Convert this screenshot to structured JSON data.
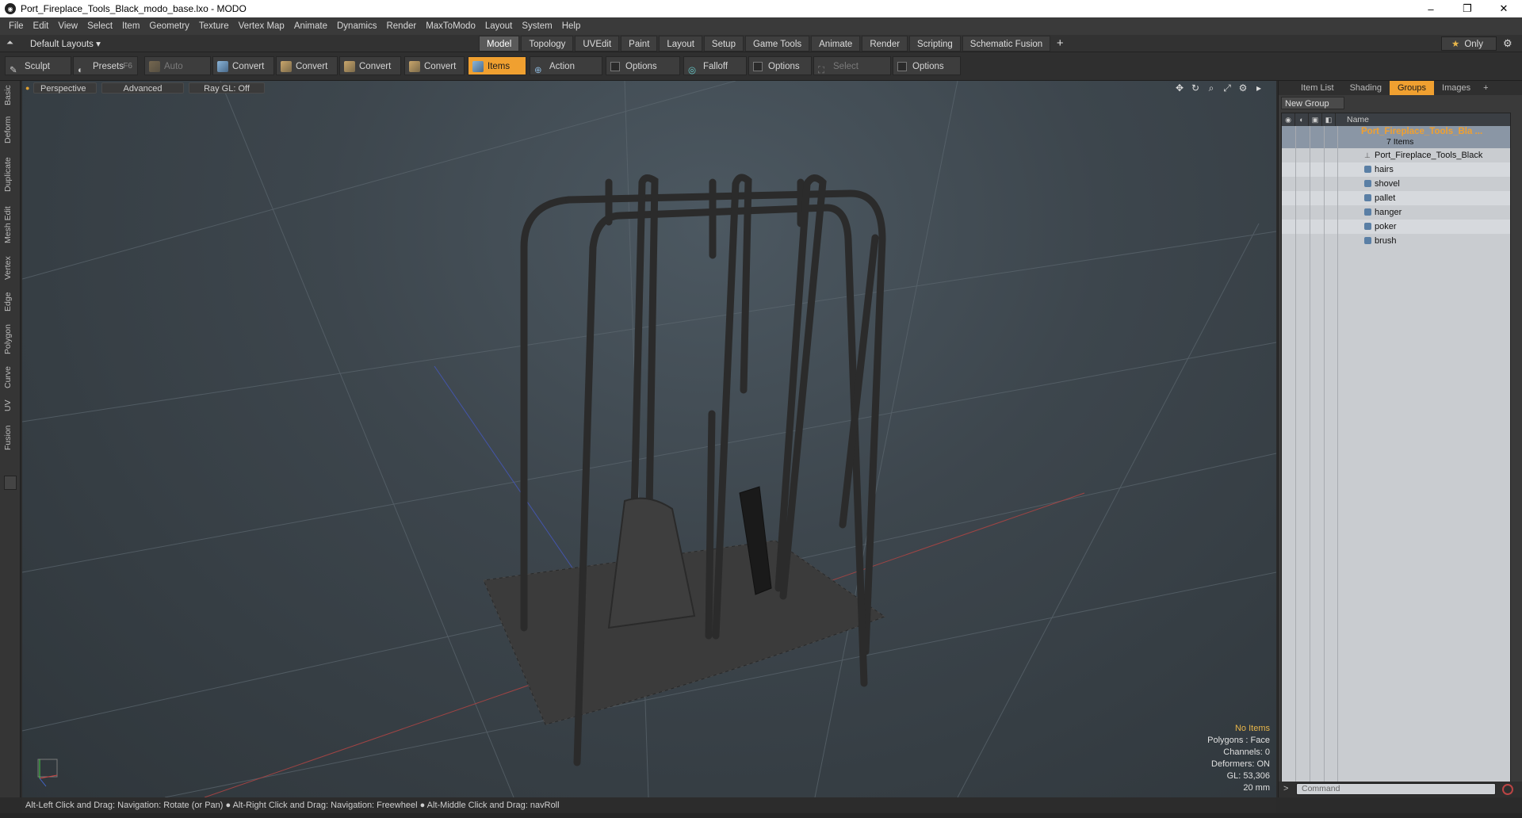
{
  "window": {
    "title": "Port_Fireplace_Tools_Black_modo_base.lxo - MODO",
    "min": "–",
    "max": "❐",
    "close": "✕"
  },
  "menu": [
    "File",
    "Edit",
    "View",
    "Select",
    "Item",
    "Geometry",
    "Texture",
    "Vertex Map",
    "Animate",
    "Dynamics",
    "Render",
    "MaxToModo",
    "Layout",
    "System",
    "Help"
  ],
  "layout": {
    "selector": "Default Layouts ▾",
    "tabs": [
      "Model",
      "Topology",
      "UVEdit",
      "Paint",
      "Layout",
      "Setup",
      "Game Tools",
      "Animate",
      "Render",
      "Scripting",
      "Schematic Fusion"
    ],
    "active_tab": "Model",
    "only": "Only",
    "plus": "+"
  },
  "toolbar": {
    "sculpt": "Sculpt",
    "presets": "Presets",
    "presets_key": "F6",
    "auto_select": "Auto Select",
    "convert": "Convert",
    "items": "Items",
    "action_center": "Action Center",
    "options": "Options",
    "falloff": "Falloff",
    "select_through": "Select Through"
  },
  "leftstrip": [
    "Basic",
    "Deform",
    "Duplicate",
    "Mesh Edit",
    "Vertex",
    "Edge",
    "Polygon",
    "Curve",
    "UV",
    "Fusion"
  ],
  "viewport": {
    "header": [
      "Perspective",
      "Advanced",
      "Ray GL: Off"
    ],
    "stats": {
      "items": "No Items",
      "polygons": "Polygons : Face",
      "channels": "Channels: 0",
      "deformers": "Deformers: ON",
      "gl": "GL: 53,306",
      "scale": "20 mm"
    }
  },
  "status": "Alt-Left Click and Drag: Navigation: Rotate (or Pan) ● Alt-Right Click and Drag: Navigation: Freewheel ● Alt-Middle Click and Drag: navRoll",
  "rightpanel": {
    "tabs": [
      "Item List",
      "Shading",
      "Groups",
      "Images"
    ],
    "active_tab": "Groups",
    "plus": "+",
    "new_group": "New Group",
    "column_name": "Name",
    "group": {
      "name": "Port_Fireplace_Tools_Bla ...",
      "count": "7 Items"
    },
    "items": [
      "Port_Fireplace_Tools_Black",
      "hairs",
      "shovel",
      "pallet",
      "hanger",
      "poker",
      "brush"
    ],
    "command_placeholder": "Command"
  },
  "colors": {
    "accent": "#f0a030",
    "viewport_bg": "#3d464d"
  }
}
